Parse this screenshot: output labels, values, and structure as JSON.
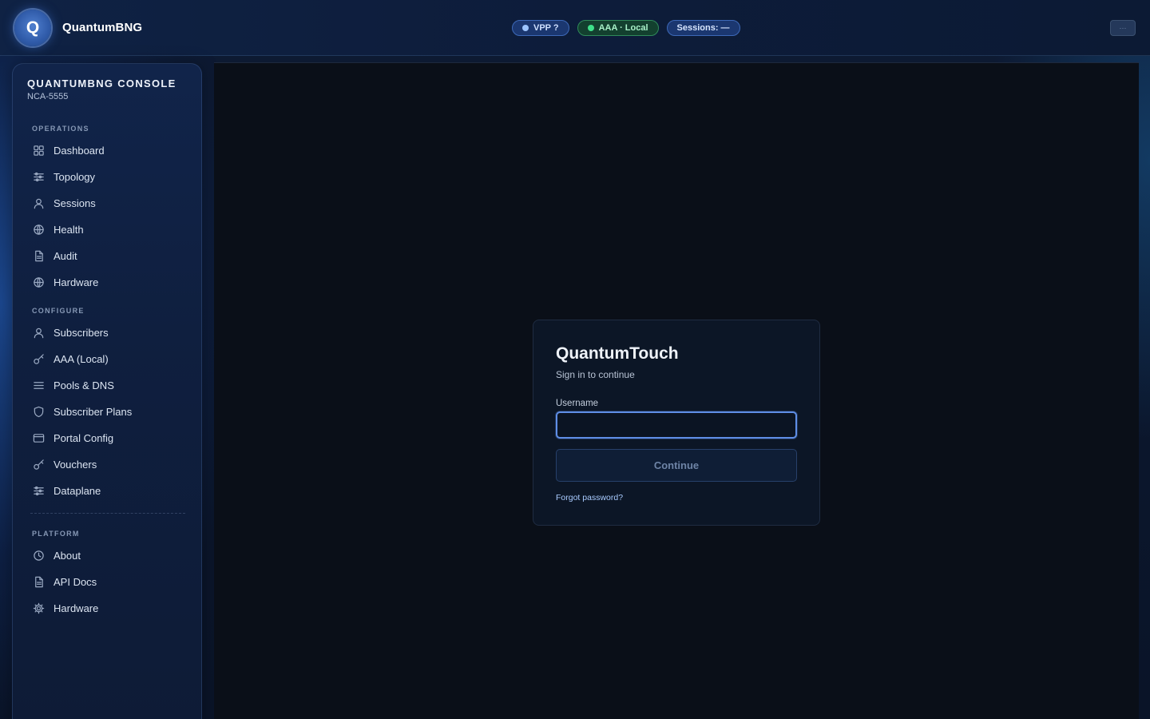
{
  "topbar": {
    "logo_letter": "Q",
    "brand_name": "QuantumBNG",
    "badges": {
      "vpp": "VPP ?",
      "aaa": "AAA · Local",
      "sessions": "Sessions: —"
    },
    "menu_button": "···"
  },
  "sidebar": {
    "title": "QUANTUMBNG CONSOLE",
    "subtitle": "NCA-5555",
    "sections": {
      "operations": {
        "label": "OPERATIONS",
        "items": [
          {
            "label": "Dashboard",
            "icon": "grid-icon"
          },
          {
            "label": "Topology",
            "icon": "sliders-icon"
          },
          {
            "label": "Sessions",
            "icon": "user-icon"
          },
          {
            "label": "Health",
            "icon": "globe-icon"
          },
          {
            "label": "Audit",
            "icon": "document-icon"
          },
          {
            "label": "Hardware",
            "icon": "globe-icon"
          }
        ]
      },
      "configure": {
        "label": "CONFIGURE",
        "items": [
          {
            "label": "Subscribers",
            "icon": "user-icon"
          },
          {
            "label": "AAA (Local)",
            "icon": "key-icon"
          },
          {
            "label": "Pools & DNS",
            "icon": "list-icon"
          },
          {
            "label": "Subscriber Plans",
            "icon": "shield-icon"
          },
          {
            "label": "Portal Config",
            "icon": "window-icon"
          },
          {
            "label": "Vouchers",
            "icon": "key-icon"
          },
          {
            "label": "Dataplane",
            "icon": "sliders-icon"
          }
        ]
      },
      "platform": {
        "label": "PLATFORM",
        "items": [
          {
            "label": "About",
            "icon": "clock-icon"
          },
          {
            "label": "API Docs",
            "icon": "document-icon"
          },
          {
            "label": "Hardware",
            "icon": "gear-icon"
          }
        ]
      }
    }
  },
  "login": {
    "title": "QuantumTouch",
    "subtitle": "Sign in to continue",
    "username_label": "Username",
    "username_value": "",
    "continue_label": "Continue",
    "forgot_label": "Forgot password?"
  }
}
